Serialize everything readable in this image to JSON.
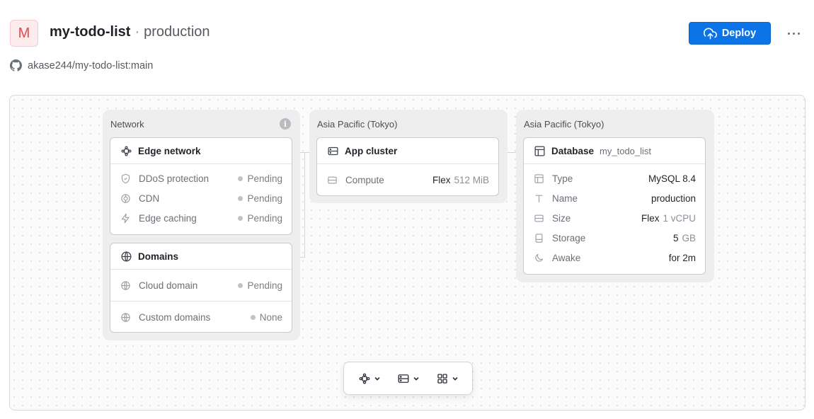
{
  "header": {
    "avatar_letter": "M",
    "app_name": "my-todo-list",
    "separator": "·",
    "environment": "production",
    "repo": "akase244/my-todo-list:main",
    "deploy_label": "Deploy"
  },
  "colors": {
    "accent": "#0d74e7",
    "avatar_bg": "#fdecee",
    "avatar_fg": "#e5484d",
    "pending_dot": "#bfc2c6"
  },
  "network": {
    "title": "Network",
    "info_label": "i",
    "edge": {
      "icon": "edge-network-icon",
      "title": "Edge network",
      "rows": [
        {
          "icon": "shield-icon",
          "label": "DDoS protection",
          "status": "Pending"
        },
        {
          "icon": "cdn-icon",
          "label": "CDN",
          "status": "Pending"
        },
        {
          "icon": "lightning-icon",
          "label": "Edge caching",
          "status": "Pending"
        }
      ]
    },
    "domains": {
      "icon": "globe-icon",
      "title": "Domains",
      "rows": [
        {
          "icon": "globe-icon",
          "label": "Cloud domain",
          "status": "Pending"
        },
        {
          "icon": "globe-icon",
          "label": "Custom domains",
          "status": "None"
        }
      ]
    }
  },
  "app_region": {
    "title": "Asia Pacific (Tokyo)",
    "card": {
      "icon": "server-icon",
      "title": "App cluster",
      "rows": [
        {
          "icon": "server-icon",
          "label": "Compute",
          "value": "Flex",
          "value_muted": "512 MiB"
        }
      ]
    }
  },
  "db_region": {
    "title": "Asia Pacific (Tokyo)",
    "card": {
      "icon": "table-icon",
      "title": "Database",
      "subtitle": "my_todo_list",
      "rows": [
        {
          "icon": "table-icon",
          "label": "Type",
          "value": "MySQL 8.4",
          "value_muted": ""
        },
        {
          "icon": "text-icon",
          "label": "Name",
          "value": "production",
          "value_muted": ""
        },
        {
          "icon": "server-icon",
          "label": "Size",
          "value": "Flex",
          "value_muted": "1 vCPU"
        },
        {
          "icon": "storage-icon",
          "label": "Storage",
          "value": "5",
          "value_muted": "GB"
        },
        {
          "icon": "moon-icon",
          "label": "Awake",
          "value": "for 2m",
          "value_muted": ""
        }
      ]
    }
  },
  "toolbar": {
    "items": [
      "edge-network-icon",
      "server-icon",
      "grid-icon"
    ]
  }
}
